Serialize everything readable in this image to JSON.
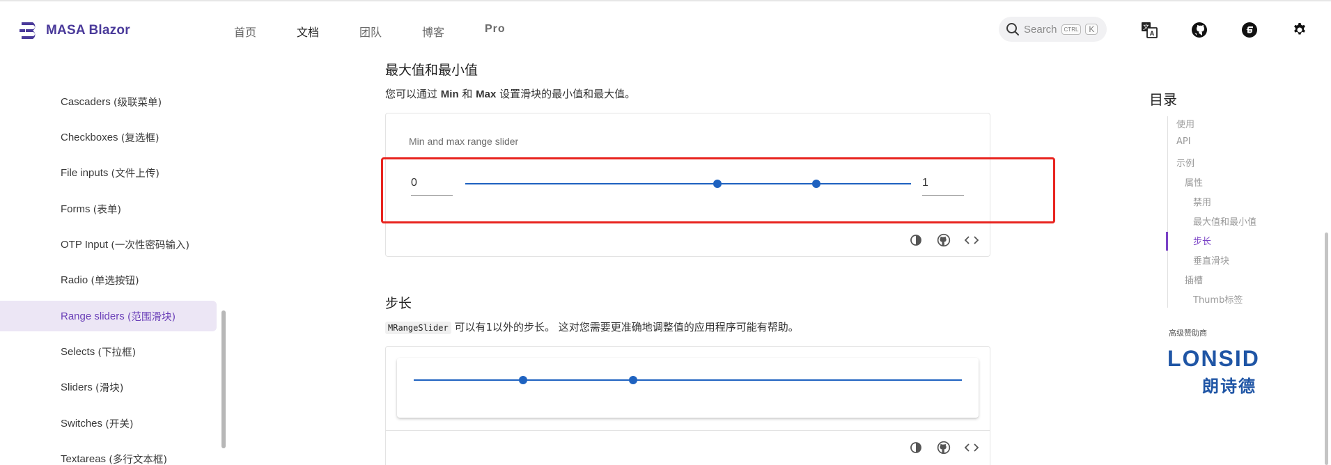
{
  "brand": {
    "name": "MASA Blazor",
    "color": "#4a3a9a"
  },
  "nav": [
    {
      "label": "首页",
      "active": false
    },
    {
      "label": "文档",
      "active": true
    },
    {
      "label": "团队",
      "active": false
    },
    {
      "label": "博客",
      "active": false
    },
    {
      "label": "Pro",
      "active": false
    }
  ],
  "search": {
    "placeholder": "Search",
    "kbd1": "CTRL",
    "kbd2": "K"
  },
  "sidebar": {
    "items": [
      {
        "label": "Cascaders",
        "zh": "(级联菜单)"
      },
      {
        "label": "Checkboxes",
        "zh": "(复选框)"
      },
      {
        "label": "File inputs",
        "zh": "(文件上传)"
      },
      {
        "label": "Forms",
        "zh": "(表单)"
      },
      {
        "label": "OTP Input",
        "zh": "(一次性密码输入)"
      },
      {
        "label": "Radio",
        "zh": "(单选按钮)"
      },
      {
        "label": "Range sliders",
        "zh": "(范围滑块)",
        "active": true
      },
      {
        "label": "Selects",
        "zh": "(下拉框)"
      },
      {
        "label": "Sliders",
        "zh": "(滑块)"
      },
      {
        "label": "Switches",
        "zh": "(开关)"
      },
      {
        "label": "Textareas",
        "zh": "(多行文本框)"
      }
    ]
  },
  "section1": {
    "title": "最大值和最小值",
    "desc_prefix": "您可以通过 ",
    "desc_b1": "Min",
    "desc_mid": " 和 ",
    "desc_b2": "Max",
    "desc_suffix": " 设置滑块的最小值和最大值。",
    "slider_label": "Min and max range slider",
    "min_value": "0",
    "max_value": "1",
    "range": [
      0.565,
      0.787
    ]
  },
  "section2": {
    "title": "步长",
    "code": "MRangeSlider",
    "desc": " 可以有1以外的步长。 这对您需要更准确地调整值的应用程序可能有帮助。",
    "range": [
      0.2,
      0.4
    ]
  },
  "toc": {
    "title": "目录",
    "items": [
      {
        "label": "使用",
        "level": 1
      },
      {
        "label": "API",
        "level": 1
      },
      {
        "label": "示例",
        "level": 1
      },
      {
        "label": "属性",
        "level": 2
      },
      {
        "label": "禁用",
        "level": 3
      },
      {
        "label": "最大值和最小值",
        "level": 3
      },
      {
        "label": "步长",
        "level": 3,
        "active": true
      },
      {
        "label": "垂直滑块",
        "level": 3
      },
      {
        "label": "插槽",
        "level": 2
      },
      {
        "label": "Thumb标签",
        "level": 3
      }
    ]
  },
  "sponsor": {
    "label": "高级赞助商",
    "name_en": "LONSID",
    "name_zh": "朗诗德"
  },
  "colors": {
    "accent": "#7a42c6",
    "slider": "#1e62c0",
    "highlight": "#e8241f",
    "sidebar_active_bg": "#ece6f5"
  }
}
